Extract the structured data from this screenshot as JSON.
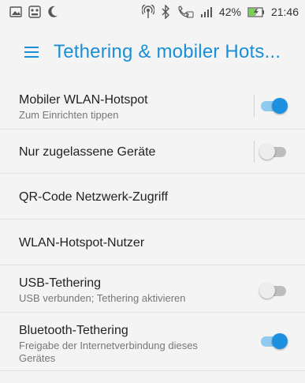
{
  "status_bar": {
    "battery_percent": "42%",
    "time": "21:46",
    "icons_left": [
      "gallery-icon",
      "recorder-icon",
      "moon-icon"
    ],
    "icons_right": [
      "hotspot-icon",
      "bluetooth-icon",
      "wifi-call-icon",
      "signal-icon",
      "battery-icon"
    ]
  },
  "app_bar": {
    "title": "Tethering & mobiler Hots...",
    "menu_icon": "hamburger-menu-icon"
  },
  "settings": [
    {
      "label": "Mobiler WLAN-Hotspot",
      "sublabel": "Zum Einrichten tippen",
      "toggle": "on"
    },
    {
      "label": "Nur zugelassene Geräte",
      "toggle": "off"
    },
    {
      "label": "QR-Code Netzwerk-Zugriff"
    },
    {
      "label": "WLAN-Hotspot-Nutzer"
    },
    {
      "label": "USB-Tethering",
      "sublabel": "USB verbunden; Tethering aktivieren",
      "toggle": "off"
    },
    {
      "label": "Bluetooth-Tethering",
      "sublabel": "Freigabe der Internetverbindung dieses Gerätes",
      "toggle": "on"
    }
  ],
  "colors": {
    "accent": "#1b8fd6",
    "toggle_on": "#1e90e0",
    "toggle_on_track": "#8fcaf0",
    "toggle_off_track": "#bdbdbd",
    "background": "#f4f4f4"
  }
}
